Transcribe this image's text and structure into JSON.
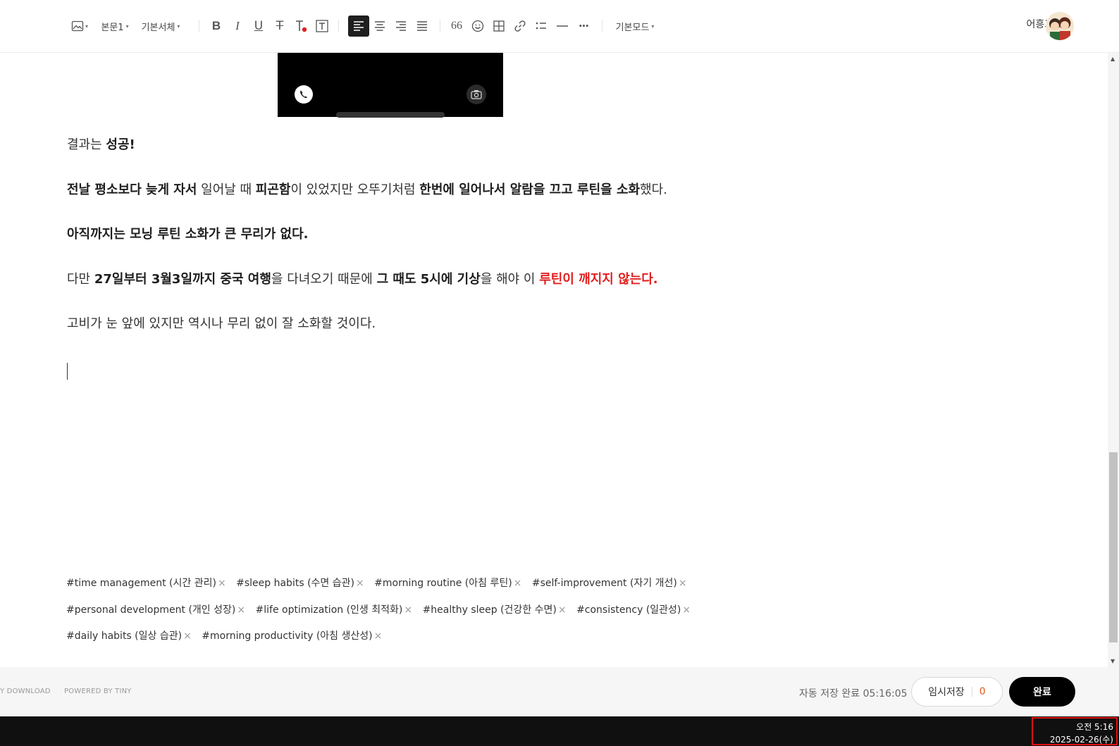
{
  "toolbar": {
    "paragraph_style": "본문1",
    "font": "기본서체",
    "mode": "기본모드",
    "quote_glyph": "66",
    "more_glyph": "···"
  },
  "user": {
    "name": "어흥꼬비"
  },
  "content": {
    "p1": {
      "a": "결과는 ",
      "b": "성공!"
    },
    "p2": {
      "a": "전날 평소보다 늦게 자서",
      "b": " 일어날 때 ",
      "c": "피곤함",
      "d": "이 있었지만 오뚜기처럼 ",
      "e": "한번에 일어나서 알람을 끄고 루틴을 소화",
      "f": "했다."
    },
    "p3": "아직까지는 모닝 루틴 소화가 큰 무리가 없다.",
    "p4": {
      "a": "다만 ",
      "b": "27일부터 3월3일까지 중국 여행",
      "c": "을 다녀오기 때문에 ",
      "d": "그 때도 5시에 기상",
      "e": "을 해야 이 ",
      "f": "루틴이 깨지지 않는다."
    },
    "p5": "고비가 눈 앞에 있지만 역시나 무리 없이 잘 소화할 것이다."
  },
  "tags": [
    "#time management (시간 관리)",
    "#sleep habits (수면 습관)",
    "#morning routine (아침 루틴)",
    "#self-improvement (자기 개선)",
    "#personal development (개인 성장)",
    "#life optimization (인생 최적화)",
    "#healthy sleep (건강한 수면)",
    "#consistency (일관성)",
    "#daily habits (일상 습관)",
    "#morning productivity (아침 생산성)"
  ],
  "tag_remove": "×",
  "footer": {
    "links": [
      "Y DOWNLOAD",
      "POWERED BY TINY"
    ],
    "autosave": "자동 저장 완료 05:16:05",
    "draft_label": "임시저장",
    "draft_count": "0",
    "done_label": "완료"
  },
  "taskbar": {
    "time": "오전 5:16",
    "date": "2025-02-26(수)"
  },
  "colors": {
    "accent_red": "#e21f1f",
    "draft_count": "#e8581c",
    "button_dark": "#000000"
  }
}
